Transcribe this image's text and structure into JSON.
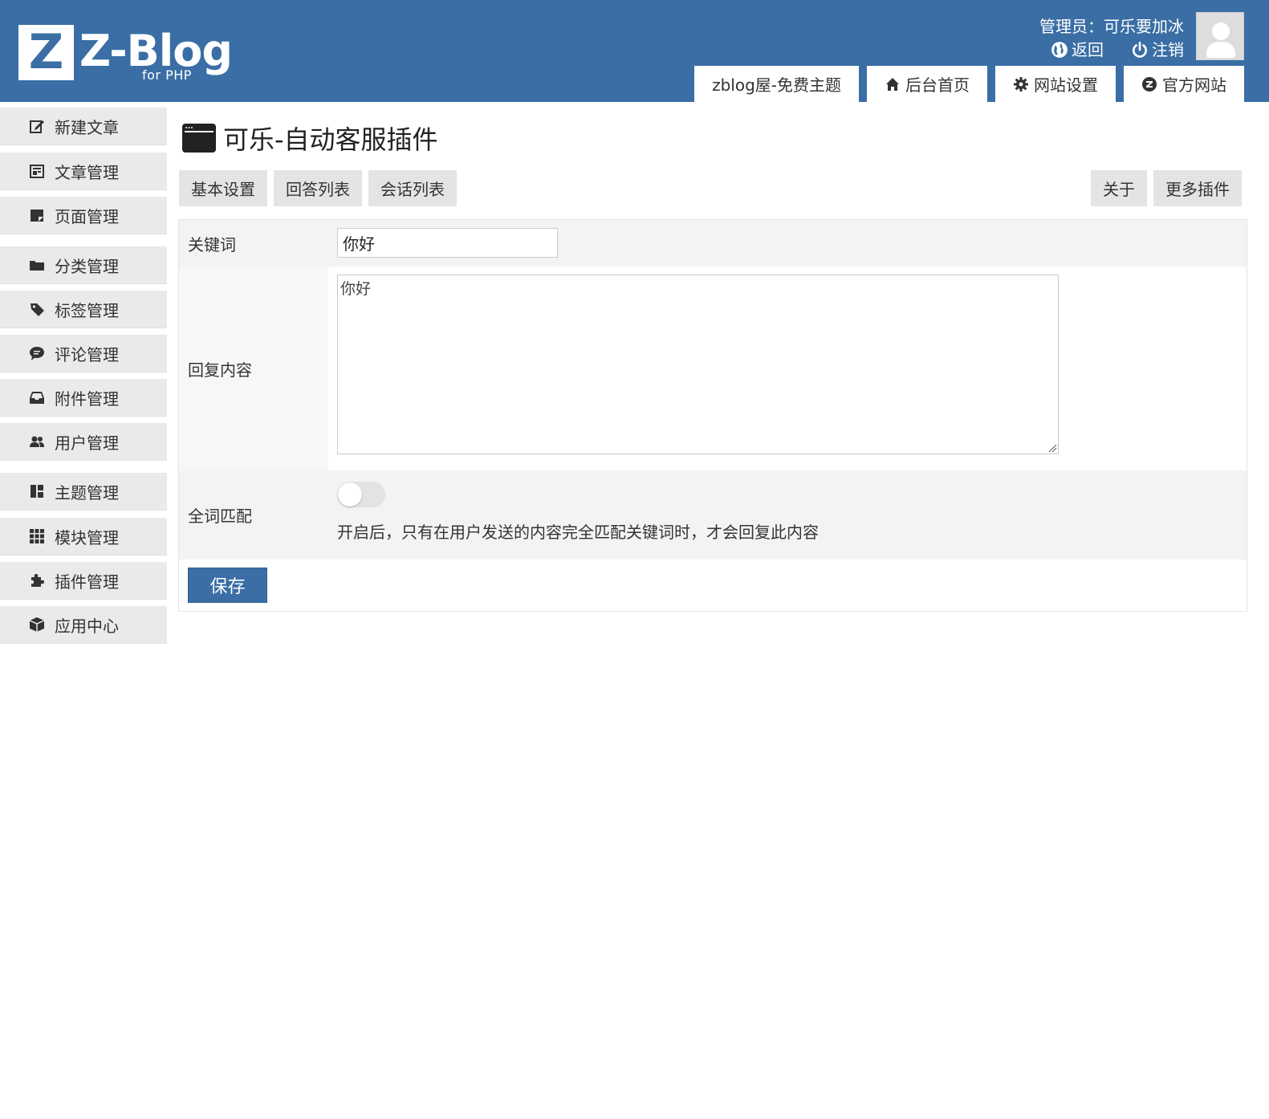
{
  "colors": {
    "brand": "#3a6ea5",
    "sidebar_bg": "#eaeaea",
    "tab_bg": "#e4e4e4"
  },
  "header": {
    "logo": {
      "letter": "Z",
      "text": "Z-Blog",
      "sub": "for PHP"
    },
    "admin_label": "管理员：可乐要加冰",
    "links": [
      {
        "icon": "globe-icon",
        "label": "返回"
      },
      {
        "icon": "power-icon",
        "label": "注销"
      }
    ],
    "tabs": [
      {
        "icon": "",
        "label": "zblog屋-免费主题"
      },
      {
        "icon": "home-icon",
        "label": "后台首页"
      },
      {
        "icon": "gear-icon",
        "label": "网站设置"
      },
      {
        "icon": "zblog-icon",
        "label": "官方网站"
      }
    ]
  },
  "sidebar": {
    "items": [
      {
        "icon": "edit-icon",
        "label": "新建文章"
      },
      {
        "icon": "article-icon",
        "label": "文章管理"
      },
      {
        "icon": "page-icon",
        "label": "页面管理"
      },
      {
        "icon": "folder-icon",
        "label": "分类管理"
      },
      {
        "icon": "tag-icon",
        "label": "标签管理"
      },
      {
        "icon": "comment-icon",
        "label": "评论管理"
      },
      {
        "icon": "inbox-icon",
        "label": "附件管理"
      },
      {
        "icon": "users-icon",
        "label": "用户管理"
      },
      {
        "icon": "theme-icon",
        "label": "主题管理"
      },
      {
        "icon": "grid-icon",
        "label": "模块管理"
      },
      {
        "icon": "puzzle-icon",
        "label": "插件管理"
      },
      {
        "icon": "box-icon",
        "label": "应用中心"
      }
    ]
  },
  "main": {
    "title": "可乐-自动客服插件",
    "tabs_left": [
      "基本设置",
      "回答列表",
      "会话列表"
    ],
    "tabs_right": [
      "关于",
      "更多插件"
    ],
    "form": {
      "keyword": {
        "label": "关键词",
        "value": "你好"
      },
      "reply": {
        "label": "回复内容",
        "value": "你好"
      },
      "full_match": {
        "label": "全词匹配",
        "enabled": false,
        "hint": "开启后，只有在用户发送的内容完全匹配关键词时，才会回复此内容"
      },
      "save_label": "保存"
    }
  }
}
